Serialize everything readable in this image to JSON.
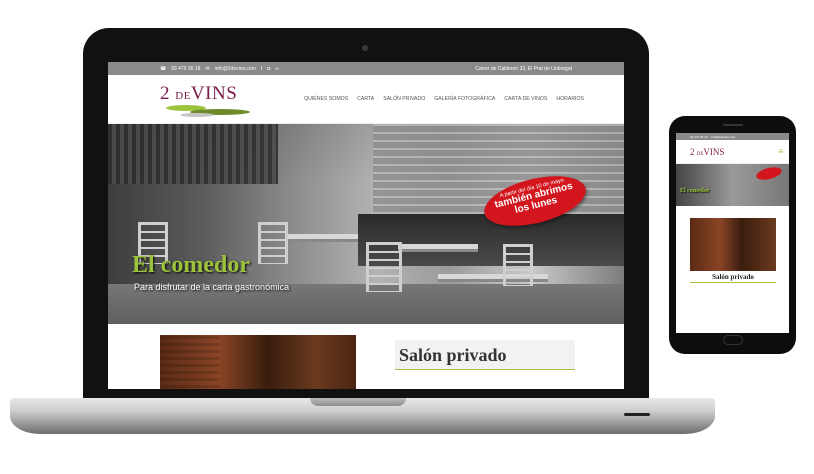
{
  "desktop": {
    "topbar": {
      "phone": "93 479 36 18",
      "email": "info@2devins.com",
      "address": "Carrer de Calderon 33, El Prat de Llobregat",
      "social_icons": [
        "facebook-icon",
        "instagram-icon",
        "tripadvisor-icon"
      ]
    },
    "logo": {
      "number": "2",
      "de": "DE",
      "name": "VINS"
    },
    "nav": [
      "QUIÉNES SOMOS",
      "CARTA",
      "SALÓN PRIVADO",
      "GALERÍA FOTOGRÁFICA",
      "CARTA DE VINOS",
      "HORARIOS"
    ],
    "hero": {
      "title": "El comedor",
      "subtitle": "Para disfrutar de la carta gastronómica",
      "badge_small": "A partir del día 10 de mayo",
      "badge_big_1": "también abrimos",
      "badge_big_2": "los lunes"
    },
    "section": {
      "title": "Salón privado"
    }
  },
  "mobile": {
    "topbar": {
      "phone": "93 479 36 18",
      "email": "info@2devins.com"
    },
    "logo": {
      "number": "2",
      "de": "DE",
      "name": "VINS"
    },
    "menu_icon": "hamburger-icon",
    "hero": {
      "title": "El comedor"
    },
    "section": {
      "title": "Salón privado"
    }
  },
  "colors": {
    "brand": "#7a1a4a",
    "accent_green": "#9cc33b",
    "badge_red": "#d3161e",
    "topbar_gray": "#8a8a8a"
  }
}
